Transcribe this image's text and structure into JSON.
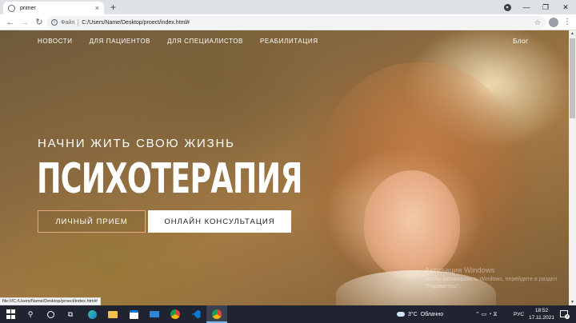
{
  "browser": {
    "tab_title": "primer",
    "tab_close": "×",
    "new_tab": "+",
    "omnibox": {
      "scheme_label": "Файл",
      "url": "C:/Users/Name/Desktop/proect/index.html#"
    },
    "status_url": "file:///C:/Users/Name/Desktop/proect/index.html#"
  },
  "site": {
    "nav": [
      "НОВОСТИ",
      "ДЛЯ ПАЦИЕНТОВ",
      "ДЛЯ СПЕЦИАЛИСТОВ",
      "РЕАБИЛИТАЦИЯ"
    ],
    "blog": "Блог",
    "hero": {
      "subtitle": "НАЧНИ ЖИТЬ СВОЮ ЖИЗНЬ",
      "title": "ПСИХОТЕРАПИЯ",
      "primary_button": "ЛИЧНЫЙ ПРИЕМ",
      "secondary_button": "ОНЛАЙН КОНСУЛЬТАЦИЯ"
    },
    "colors": {
      "primary_button_border": "#e8a885",
      "secondary_button_bg": "#ffffff"
    }
  },
  "windows_watermark": {
    "title": "Активация Windows",
    "text": "Чтобы активировать Windows, перейдите в раздел \"Параметры\"."
  },
  "taskbar": {
    "weather_temp": "3°C",
    "weather_text": "Облачно",
    "tray_symbols": "⌃ ▭ ◔ ⧖",
    "language": "РУС",
    "time": "18:52",
    "date": "17.11.2021",
    "notifications": "3"
  }
}
